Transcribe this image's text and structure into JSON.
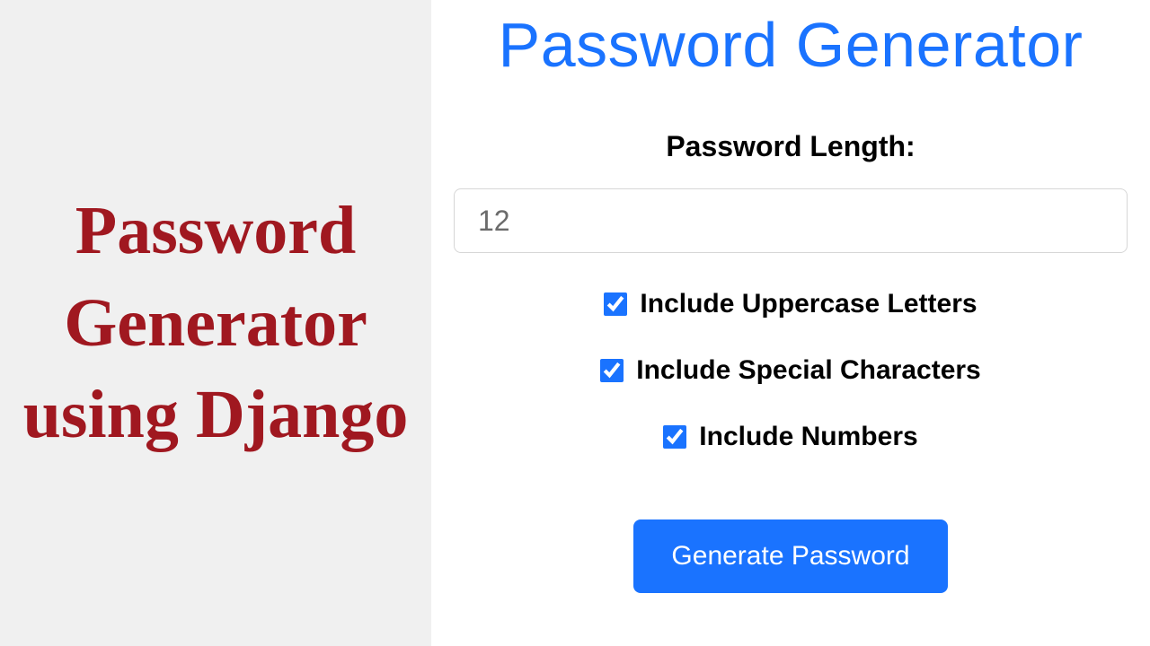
{
  "leftPanel": {
    "title": "Password Generator using Django"
  },
  "header": {
    "title": "Password Generator"
  },
  "form": {
    "lengthLabel": "Password Length:",
    "lengthValue": "12",
    "options": [
      {
        "label": "Include Uppercase Letters",
        "checked": true
      },
      {
        "label": "Include Special Characters",
        "checked": true
      },
      {
        "label": "Include Numbers",
        "checked": true
      }
    ],
    "buttonLabel": "Generate Password"
  }
}
